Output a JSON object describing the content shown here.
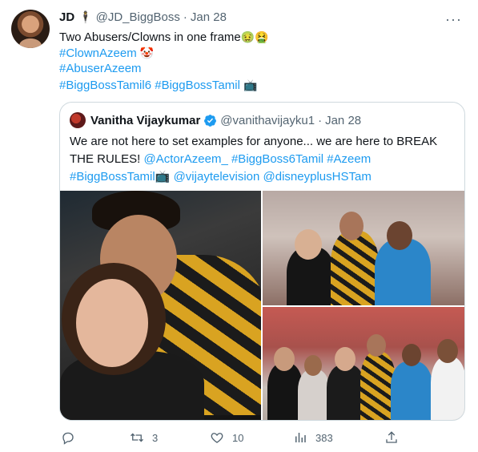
{
  "tweet": {
    "display_name": "JD",
    "name_emoji": "🕴",
    "handle": "@JD_BiggBoss",
    "separator": "·",
    "date": "Jan 28",
    "lines": [
      {
        "text": "Two Abusers/Clowns in one frame",
        "emoji": "🤢🤮"
      },
      {
        "text": "#ClownAzeem",
        "emoji": "🤡"
      },
      {
        "text": "#AbuserAzeem",
        "emoji": ""
      },
      {
        "text": "#BiggBossTamil6 #BiggBossTamil",
        "emoji": "📺"
      }
    ],
    "more_icon": "more-horizontal-icon"
  },
  "quote": {
    "display_name": "Vanitha Vijaykumar",
    "handle": "@vanithavijayku1",
    "separator": "·",
    "date": "Jan 28",
    "verified_color": "#1d9bf0",
    "text_line1": "We are not here to set examples for anyone... we are here to BREAK",
    "text_line2_pre": "THE RULES! ",
    "mention_azeem": "@ActorAzeem_",
    "hashtag_bb6": "#BiggBoss6Tamil",
    "hashtag_azeem": "#Azeem",
    "hashtag_bbt": "#BiggBossTamil",
    "hashtag_emoji": "📺",
    "mention_vijay": "@vijaytelevision",
    "mention_disney": "@disneyplusHSTam"
  },
  "actions": {
    "reply_count": "",
    "retweet_count": "3",
    "like_count": "10",
    "views_count": "383",
    "share_count": ""
  },
  "colors": {
    "link": "#1d9bf0",
    "secondary_text": "#536471",
    "border": "#cfd9de"
  }
}
